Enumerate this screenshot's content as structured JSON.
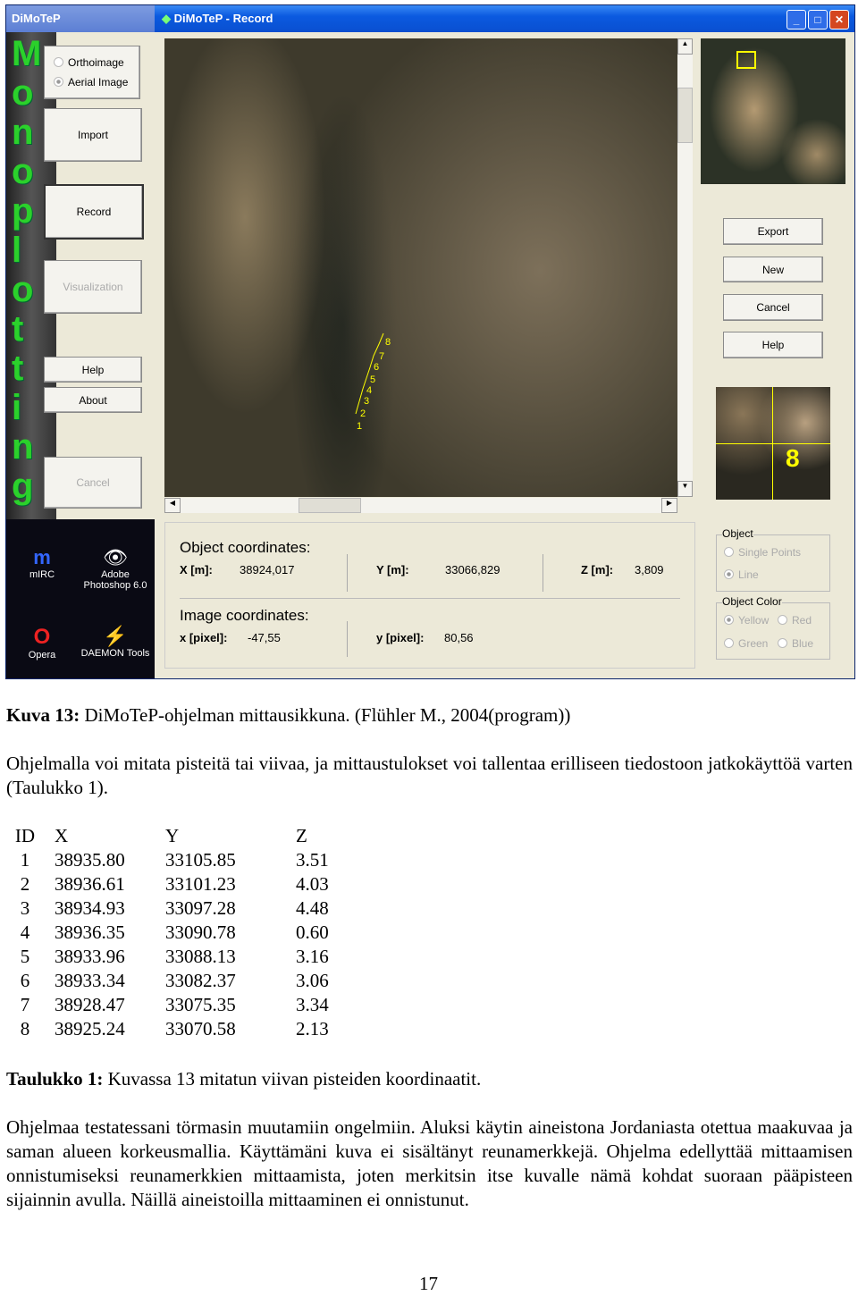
{
  "window": {
    "back_title": "DiMoTeP",
    "title": "DiMoTeP - Record"
  },
  "logo_letters": [
    "M",
    "o",
    "n",
    "o",
    "p",
    "l",
    "o",
    "t",
    "t",
    "i",
    "n",
    "g"
  ],
  "left_panel": {
    "image_type": [
      {
        "label": "Orthoimage",
        "selected": false
      },
      {
        "label": "Aerial Image",
        "selected": true
      }
    ],
    "import": "Import",
    "record": "Record",
    "visualization": "Visualization",
    "help": "Help",
    "about": "About",
    "cancel": "Cancel"
  },
  "desktop_icons": [
    {
      "label": "mIRC"
    },
    {
      "label": "Adobe Photoshop 6.0"
    },
    {
      "label": "Opera"
    },
    {
      "label": "DAEMON Tools"
    }
  ],
  "point_labels": [
    "1",
    "2",
    "3",
    "4",
    "5",
    "6",
    "7",
    "8"
  ],
  "right_panel": {
    "export": "Export",
    "new": "New",
    "cancel": "Cancel",
    "help": "Help",
    "zoom_label": "8",
    "object_group": {
      "title": "Object",
      "options": [
        {
          "label": "Single Points",
          "selected": false
        },
        {
          "label": "Line",
          "selected": true
        }
      ]
    },
    "color_group": {
      "title": "Object Color",
      "options": [
        {
          "label": "Yellow",
          "selected": true
        },
        {
          "label": "Red",
          "selected": false
        },
        {
          "label": "Green",
          "selected": false
        },
        {
          "label": "Blue",
          "selected": false
        }
      ]
    }
  },
  "coords": {
    "object_title": "Object coordinates:",
    "x_label": "X [m]:",
    "x": "38924,017",
    "y_label": "Y [m]:",
    "y": "33066,829",
    "z_label": "Z [m]:",
    "z": "3,809",
    "image_title": "Image coordinates:",
    "px_label": "x [pixel]:",
    "px": "-47,55",
    "py_label": "y [pixel]:",
    "py": "80,56"
  },
  "caption": {
    "bold": "Kuva 13:",
    "text": " DiMoTeP-ohjelman mittausikkuna. (Flühler M., 2004(program))"
  },
  "para1": "Ohjelmalla voi mitata pisteitä tai viivaa, ja mittaustulokset voi tallentaa erilliseen tiedostoon jatkokäyttöä varten (Taulukko 1).",
  "table": {
    "headers": [
      "ID",
      "X",
      "Y",
      "Z"
    ],
    "rows": [
      [
        "1",
        "38935.80",
        "33105.85",
        "3.51"
      ],
      [
        "2",
        "38936.61",
        "33101.23",
        "4.03"
      ],
      [
        "3",
        "38934.93",
        "33097.28",
        "4.48"
      ],
      [
        "4",
        "38936.35",
        "33090.78",
        "0.60"
      ],
      [
        "5",
        "38933.96",
        "33088.13",
        "3.16"
      ],
      [
        "6",
        "38933.34",
        "33082.37",
        "3.06"
      ],
      [
        "7",
        "38928.47",
        "33075.35",
        "3.34"
      ],
      [
        "8",
        "38925.24",
        "33070.58",
        "2.13"
      ]
    ]
  },
  "table_caption": {
    "bold": "Taulukko 1:",
    "text": " Kuvassa 13 mitatun viivan pisteiden koordinaatit."
  },
  "para2": "Ohjelmaa testatessani törmasin muutamiin ongelmiin. Aluksi käytin aineistona Jordaniasta otettua maakuvaa ja saman alueen korkeusmallia. Käyttämäni kuva ei sisältänyt reunamerkkejä. Ohjelma edellyttää mittaamisen onnistumiseksi reunamerkkien mittaamista, joten merkitsin itse kuvalle nämä kohdat suoraan pääpisteen sijainnin avulla. Näillä aineistoilla mittaaminen ei onnistunut.",
  "page_number": "17"
}
